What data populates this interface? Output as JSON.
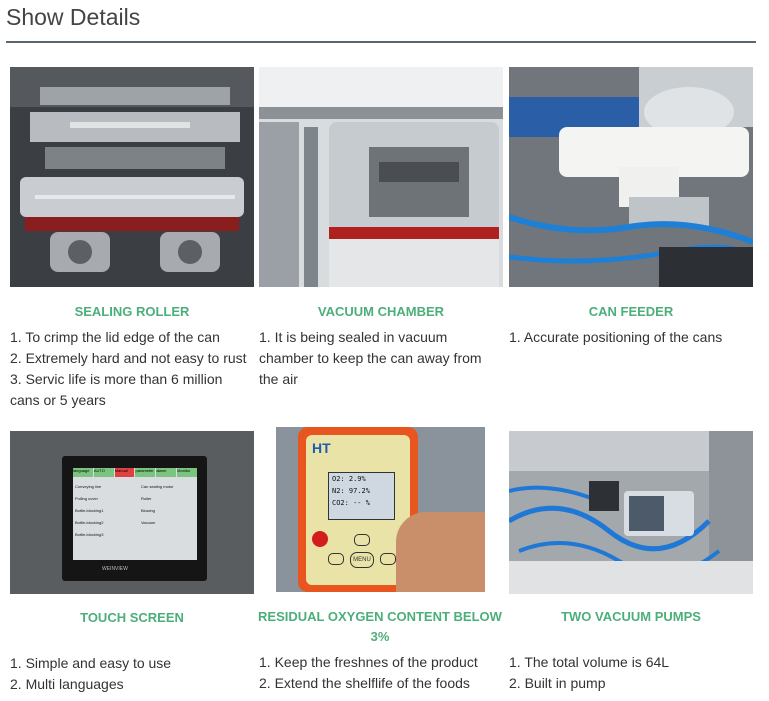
{
  "section": {
    "title": "Show Details"
  },
  "cards": [
    {
      "caption": "SEALING ROLLER",
      "lines": [
        "1. To crimp the lid edge of the can",
        "2. Extremely hard and not easy to rust",
        "3. Servic life is more than 6 million",
        "cans  or 5 years"
      ]
    },
    {
      "caption": "VACUUM CHAMBER",
      "lines": [
        "1. It is being sealed in vacuum",
        "chamber to keep the can away from",
        "the air"
      ]
    },
    {
      "caption": "CAN FEEDER",
      "lines": [
        "1. Accurate positioning of the cans"
      ]
    },
    {
      "caption": "TOUCH SCREEN",
      "lines": [
        "1. Simple and easy to use",
        "2. Multi languages"
      ]
    },
    {
      "caption": "RESIDUAL OXYGEN CONTENT BELOW",
      "caption2": "3%",
      "lines": [
        "1. Keep the freshnes of the product",
        "2. Extend the shelflife of the foods"
      ]
    },
    {
      "caption": "TWO VACUUM PUMPS",
      "lines": [
        "1.  The total volume is 64L",
        "2. Built in pump"
      ]
    }
  ],
  "screen_ui": {
    "tabs": [
      "language",
      "AUTO",
      "Manual",
      "parameter",
      "alarm",
      "Monitor"
    ],
    "rows": [
      "Conveying line",
      "Pulling cover",
      "Bottle-blocking1",
      "Bottle-blocking2",
      "Bottle-blocking3"
    ],
    "right_rows": [
      "Can sealing motor",
      "Roller",
      "Blowing",
      "Vacuum"
    ],
    "brand": "WEINVIEW"
  },
  "meter": {
    "brand": "HT",
    "readings": [
      "O2:   2.9%",
      "N2:  97.2%",
      "CO2:  -- %"
    ],
    "menu_label": "MENU"
  },
  "colors": {
    "accent": "#4caf7a",
    "rule": "#5a6670"
  }
}
